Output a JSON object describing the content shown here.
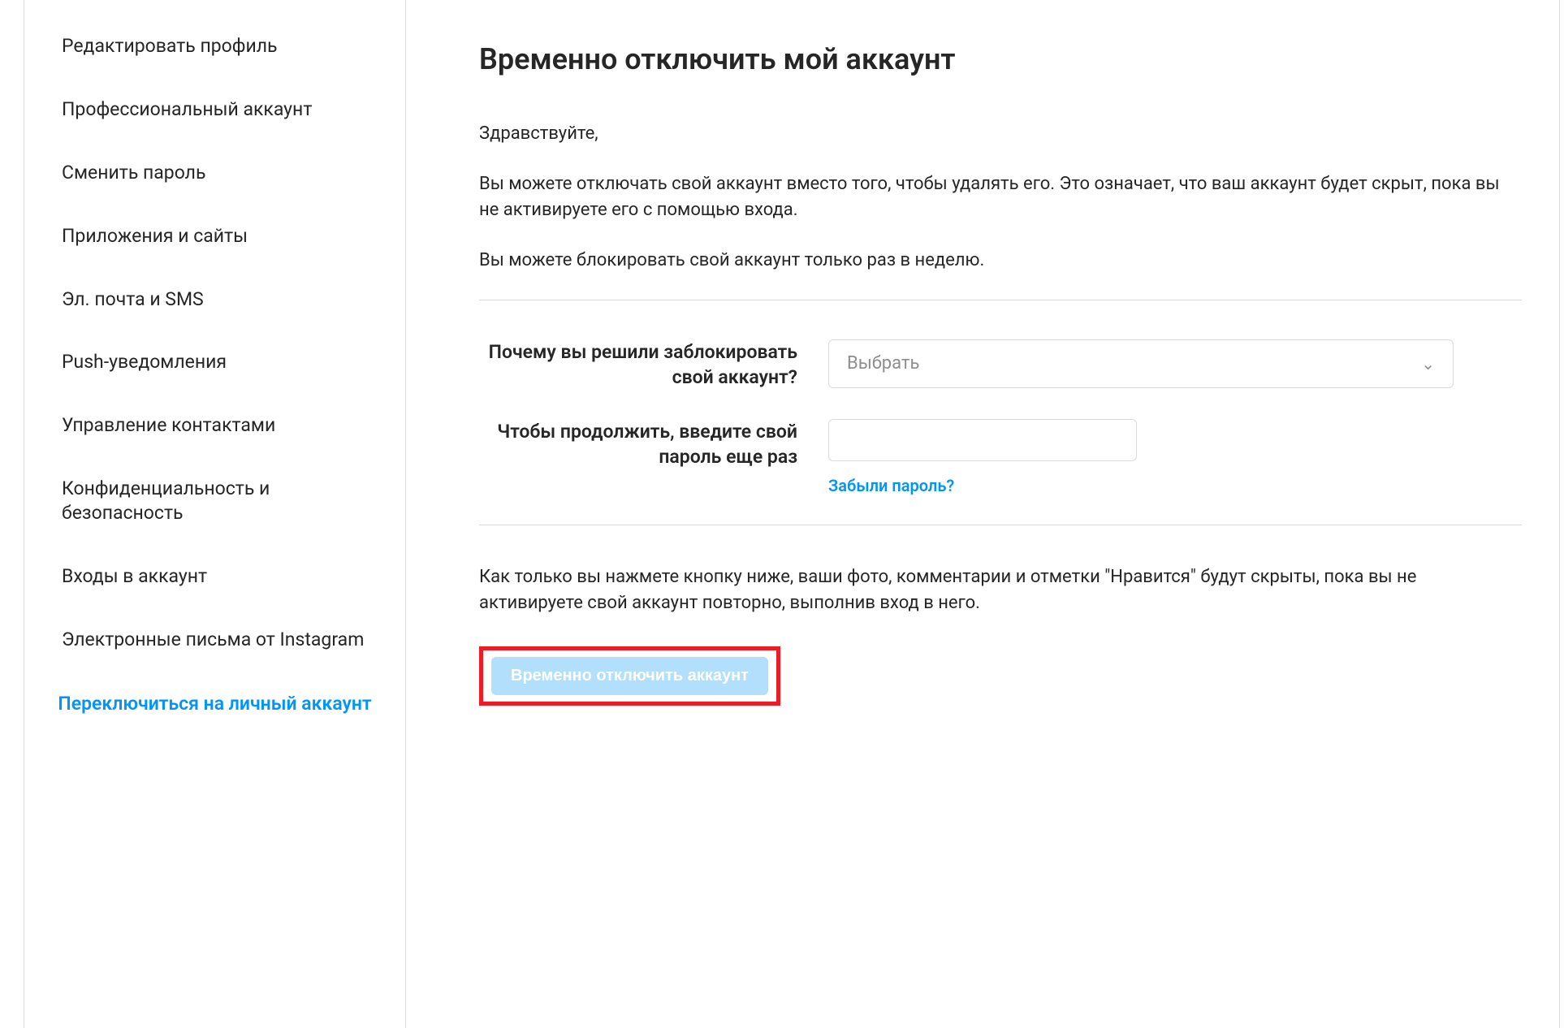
{
  "sidebar": {
    "items": [
      {
        "label": "Редактировать профиль"
      },
      {
        "label": "Профессиональный аккаунт"
      },
      {
        "label": "Сменить пароль"
      },
      {
        "label": "Приложения и сайты"
      },
      {
        "label": "Эл. почта и SMS"
      },
      {
        "label": "Push-уведомления"
      },
      {
        "label": "Управление контактами"
      },
      {
        "label": "Конфиденциальность и безопасность"
      },
      {
        "label": "Входы в аккаунт"
      },
      {
        "label": "Электронные письма от Instagram"
      }
    ],
    "switch_link": "Переключиться на личный аккаунт"
  },
  "main": {
    "title": "Временно отключить мой аккаунт",
    "greeting": "Здравствуйте,",
    "body1": "Вы можете отключать свой аккаунт вместо того, чтобы удалять его. Это означает, что ваш аккаунт будет скрыт, пока вы не активируете его с помощью входа.",
    "body2": "Вы можете блокировать свой аккаунт только раз в неделю.",
    "reason_label": "Почему вы решили заблокировать свой аккаунт?",
    "reason_placeholder": "Выбрать",
    "password_label": "Чтобы продолжить, введите свой пароль еще раз",
    "forgot_password": "Забыли пароль?",
    "confirm_note": "Как только вы нажмете кнопку ниже, ваши фото, комментарии и отметки \"Нравится\" будут скрыты, пока вы не активируете свой аккаунт повторно, выполнив вход в него.",
    "disable_button": "Временно отключить аккаунт"
  },
  "colors": {
    "link": "#0095f6",
    "highlight_border": "#ed1c24",
    "disabled_btn_bg": "#b2dffc"
  }
}
